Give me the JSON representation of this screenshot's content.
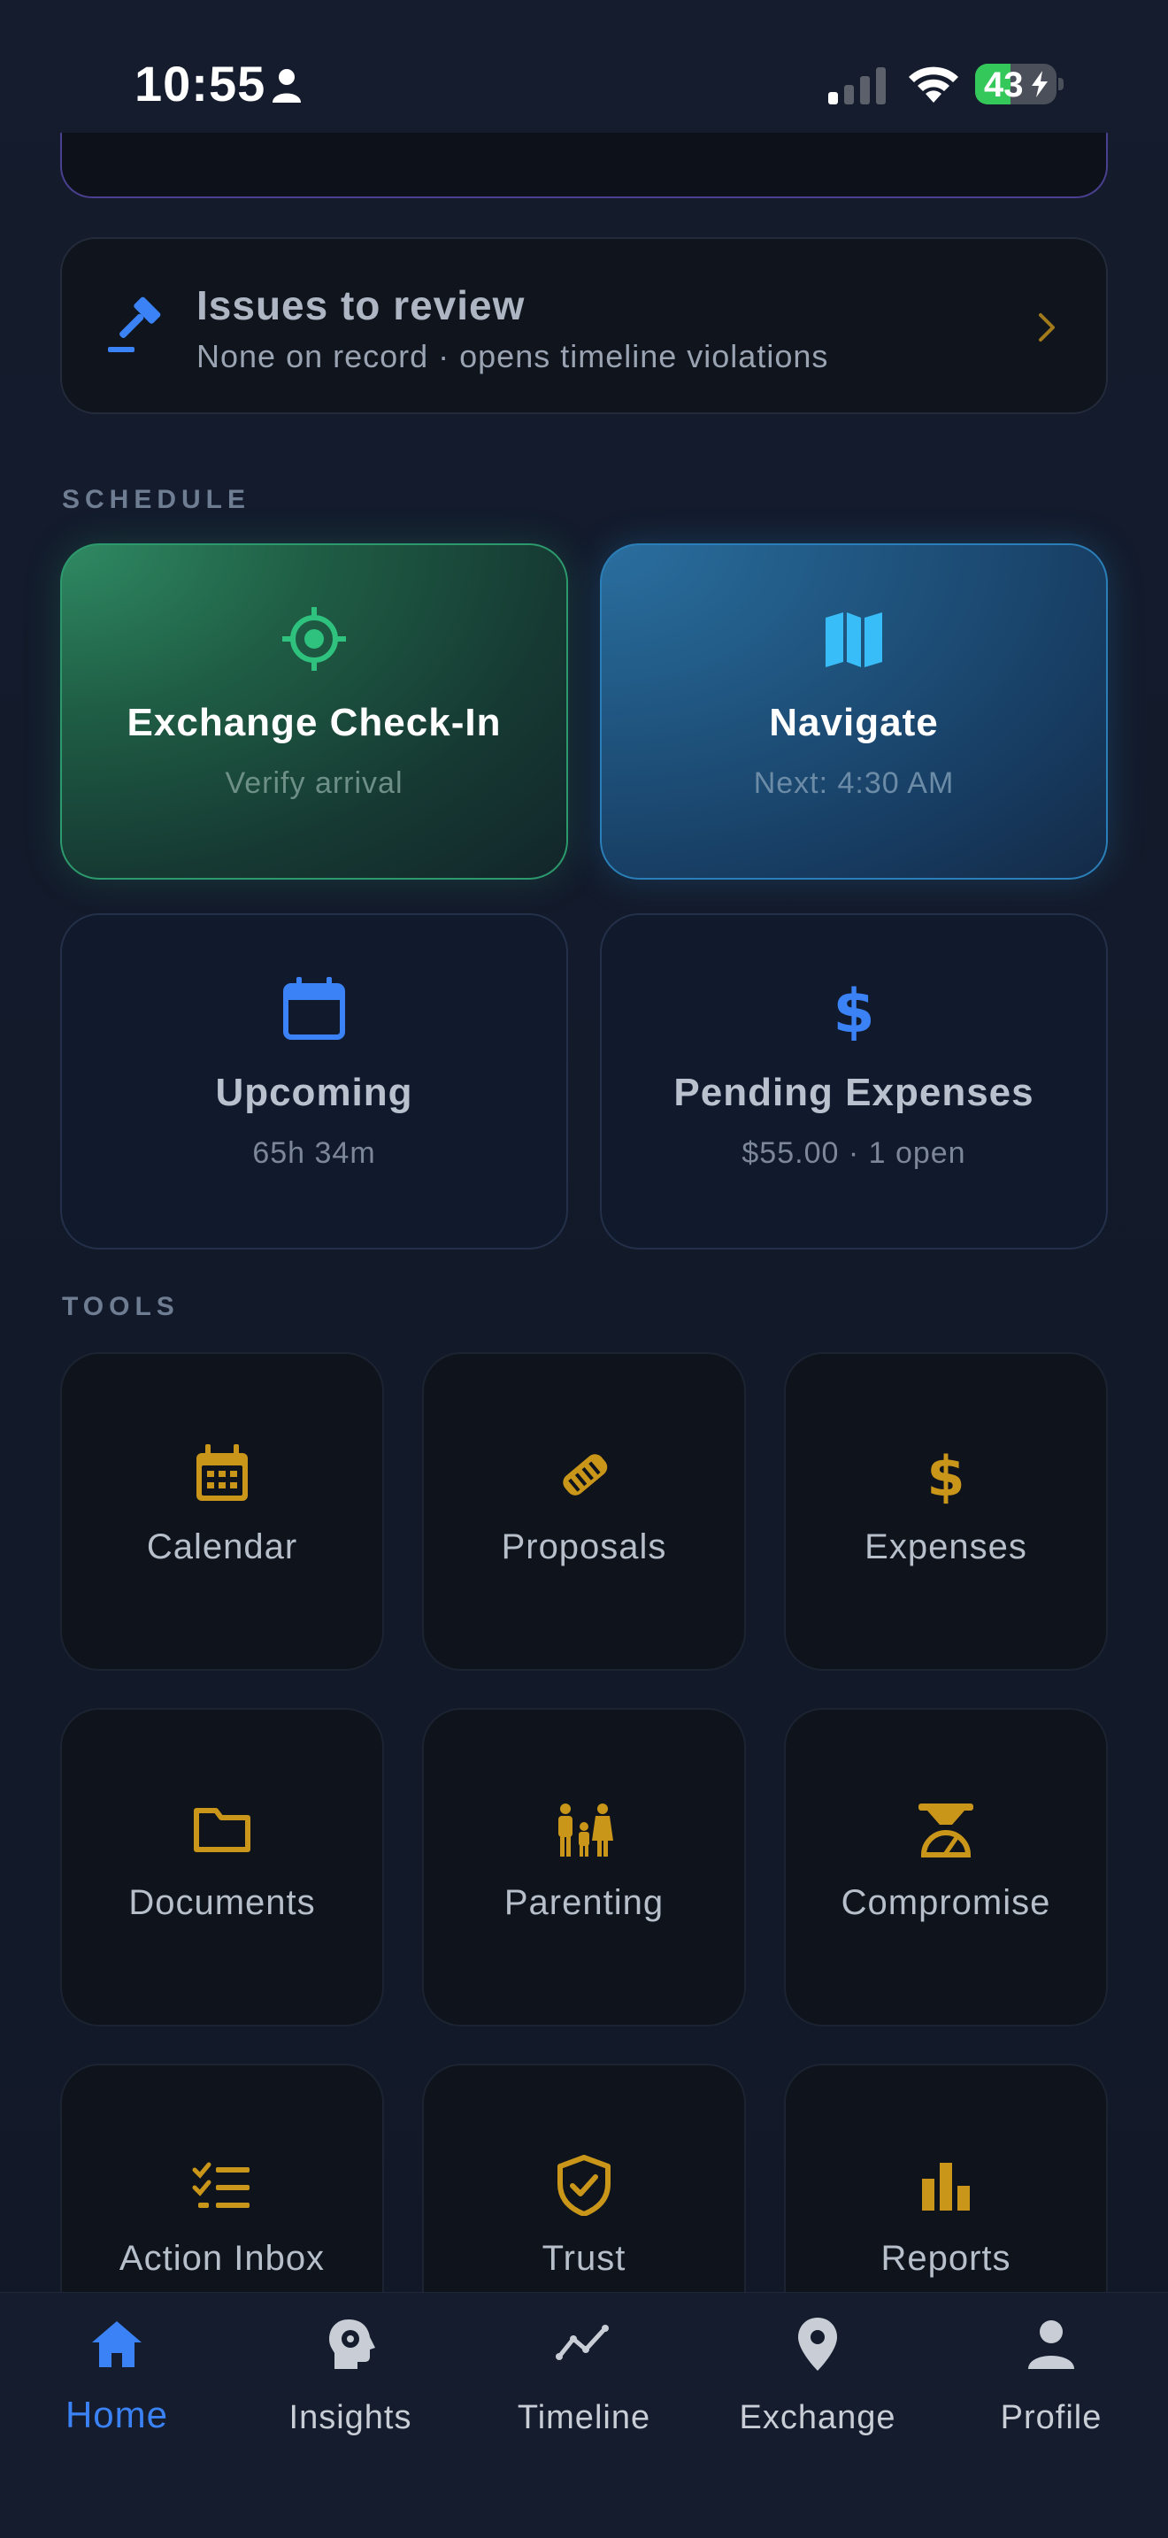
{
  "status_bar": {
    "time": "10:55",
    "battery": "43",
    "battery_level_percent": 43
  },
  "issues": {
    "title": "Issues to review",
    "subtitle": "None on record · opens timeline violations"
  },
  "sections": {
    "schedule": "SCHEDULE",
    "tools": "TOOLS"
  },
  "schedule": {
    "checkin": {
      "title": "Exchange Check-In",
      "subtitle": "Verify arrival",
      "icon": "crosshair-icon"
    },
    "navigate": {
      "title": "Navigate",
      "subtitle": "Next: 4:30 AM",
      "icon": "map-icon"
    },
    "upcoming": {
      "title": "Upcoming",
      "subtitle": "65h 34m",
      "icon": "calendar-icon"
    },
    "expenses": {
      "title": "Pending Expenses",
      "subtitle": "$55.00 · 1 open",
      "icon": "dollar-icon"
    }
  },
  "tools": [
    {
      "label": "Calendar",
      "icon": "calendar-grid-icon"
    },
    {
      "label": "Proposals",
      "icon": "handshake-icon"
    },
    {
      "label": "Expenses",
      "icon": "dollar-icon"
    },
    {
      "label": "Documents",
      "icon": "folder-icon"
    },
    {
      "label": "Parenting",
      "icon": "family-icon"
    },
    {
      "label": "Compromise",
      "icon": "scale-icon"
    },
    {
      "label": "Action Inbox",
      "icon": "checklist-icon"
    },
    {
      "label": "Trust",
      "icon": "shield-check-icon"
    },
    {
      "label": "Reports",
      "icon": "bar-chart-icon"
    }
  ],
  "nav": [
    {
      "label": "Home",
      "icon": "home-icon",
      "active": true
    },
    {
      "label": "Insights",
      "icon": "head-gear-icon"
    },
    {
      "label": "Timeline",
      "icon": "line-chart-icon"
    },
    {
      "label": "Exchange",
      "icon": "location-pin-icon"
    },
    {
      "label": "Profile",
      "icon": "person-icon"
    }
  ],
  "colors": {
    "accent_blue": "#3b82f6",
    "checkin_green": "#2ec27e",
    "navigate_blue": "#38bdf8",
    "tool_gold": "#c9961a",
    "background": "#121a2b"
  }
}
